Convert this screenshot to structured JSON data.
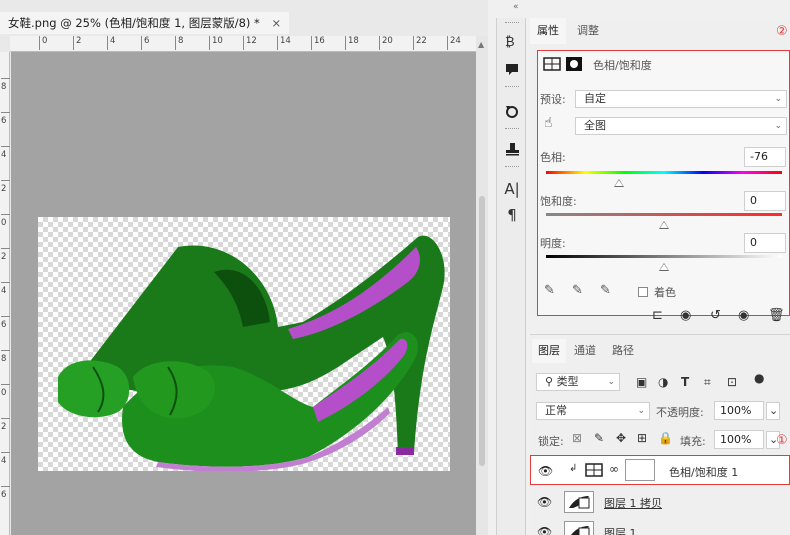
{
  "document": {
    "tab_title": "女鞋.png @ 25% (色相/饱和度 1, 图层蒙版/8) *",
    "close_glyph": "×",
    "ruler_h_ticks": [
      "0",
      "2",
      "4",
      "6",
      "8",
      "10",
      "12",
      "14",
      "16",
      "18",
      "20",
      "22",
      "24"
    ],
    "ruler_v_ticks": [
      "8",
      "6",
      "4",
      "2",
      "0",
      "2",
      "4",
      "6",
      "8",
      "0",
      "2",
      "4",
      "6"
    ],
    "image_description_colors": {
      "shoe": "#1a8a1a",
      "lining": "#b54fc9",
      "canvas": "#a3a3a3"
    }
  },
  "toolbar": {
    "collapse_glyph": "«",
    "icons": [
      "history-icon",
      "comment-icon",
      "rotate-icon",
      "stamp-icon",
      "text-icon",
      "paragraph-icon"
    ]
  },
  "properties": {
    "tabs": [
      "属性",
      "调整"
    ],
    "active_tab": "属性",
    "marker": "②",
    "adjustment_title": "色相/饱和度",
    "preset_label": "预设:",
    "preset_value": "自定",
    "channel_value": "全图",
    "hue_label": "色相:",
    "hue_value": "-76",
    "hue_fraction": 0.31,
    "saturation_label": "饱和度:",
    "saturation_value": "0",
    "saturation_fraction": 0.5,
    "lightness_label": "明度:",
    "lightness_value": "0",
    "lightness_fraction": 0.5,
    "colorize_label": "着色",
    "accent_color": "#e23b3b"
  },
  "layers": {
    "tabs": [
      "图层",
      "通道",
      "路径"
    ],
    "active_tab": "图层",
    "filter_label": "类型",
    "blend_mode": "正常",
    "opacity_label": "不透明度:",
    "opacity_value": "100%",
    "lock_label": "锁定:",
    "fill_label": "填充:",
    "fill_value": "100%",
    "marker": "①",
    "rows": [
      {
        "name": "色相/饱和度 1",
        "selected": true
      },
      {
        "name": "图层 1 拷贝",
        "selected": false
      },
      {
        "name": "图层 1",
        "selected": false
      }
    ]
  }
}
